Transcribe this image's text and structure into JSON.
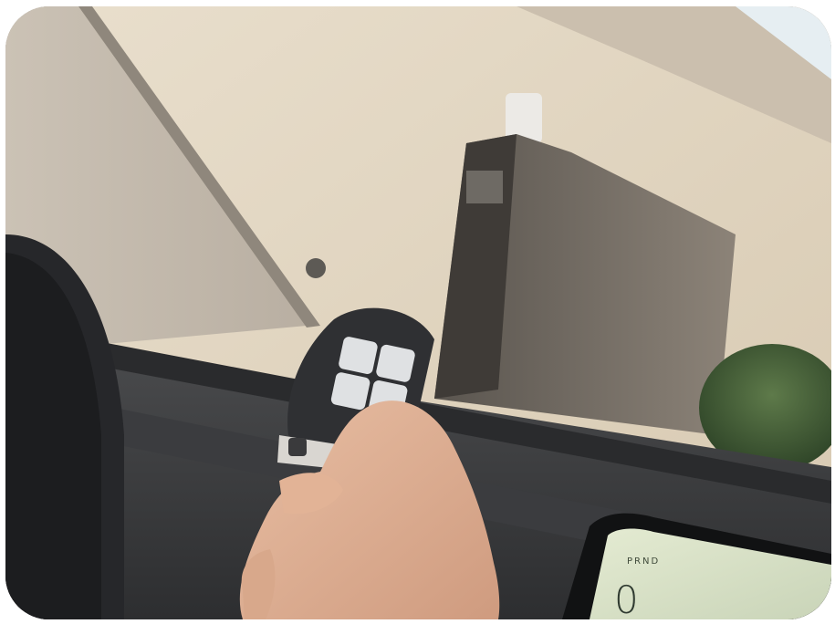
{
  "photo": {
    "subject": "hand-holding-remote",
    "dashboard_display": {
      "gear_indicator": "PRND",
      "speed_readout": "0"
    }
  }
}
